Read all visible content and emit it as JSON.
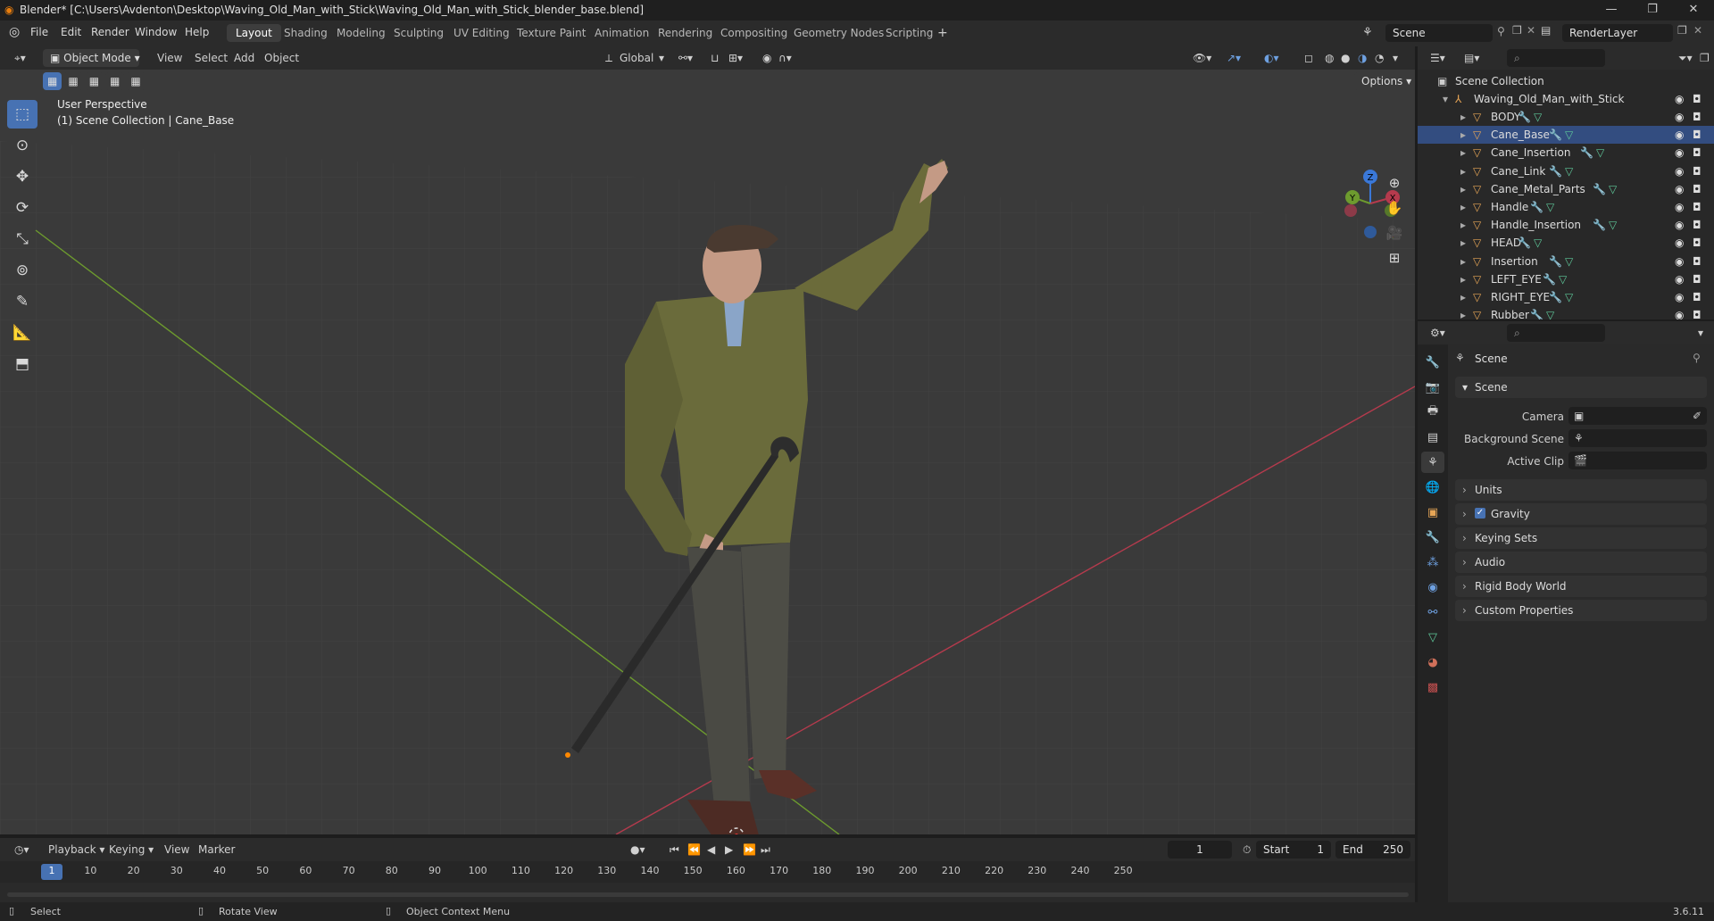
{
  "window": {
    "title": "Blender* [C:\\Users\\Avdenton\\Desktop\\Waving_Old_Man_with_Stick\\Waving_Old_Man_with_Stick_blender_base.blend]",
    "minimize": "—",
    "maximize": "❐",
    "close": "✕"
  },
  "menubar": {
    "menus": [
      "File",
      "Edit",
      "Render",
      "Window",
      "Help"
    ],
    "workspaces": [
      "Layout",
      "Shading",
      "Modeling",
      "Sculpting",
      "UV Editing",
      "Texture Paint",
      "Animation",
      "Rendering",
      "Compositing",
      "Geometry Nodes",
      "Scripting"
    ],
    "active_workspace": "Layout",
    "add_workspace": "+",
    "scene": "Scene",
    "view_layer": "RenderLayer"
  },
  "viewport_header": {
    "mode": "Object Mode",
    "menus": [
      "View",
      "Select",
      "Add",
      "Object"
    ],
    "orientation": "Global",
    "options": "Options"
  },
  "viewport": {
    "perspective": "User Perspective",
    "context": "(1) Scene Collection | Cane_Base",
    "gizmo": {
      "x": "X",
      "y": "Y",
      "z": "Z"
    }
  },
  "timeline": {
    "menus": [
      "Playback",
      "Keying",
      "View",
      "Marker"
    ],
    "current_frame": "1",
    "start_label": "Start",
    "start": "1",
    "end_label": "End",
    "end": "250",
    "ticks": [
      "1",
      "10",
      "20",
      "30",
      "40",
      "50",
      "60",
      "70",
      "80",
      "90",
      "100",
      "110",
      "120",
      "130",
      "140",
      "150",
      "160",
      "170",
      "180",
      "190",
      "200",
      "210",
      "220",
      "230",
      "240",
      "250"
    ]
  },
  "statusbar": {
    "select": "Select",
    "rotate": "Rotate View",
    "context_menu": "Object Context Menu",
    "version": "3.6.11"
  },
  "outliner": {
    "root": "Scene Collection",
    "collection": "Waving_Old_Man_with_Stick",
    "objects": [
      "BODY",
      "Cane_Base",
      "Cane_Insertion",
      "Cane_Link",
      "Cane_Metal_Parts",
      "Handle",
      "Handle_Insertion",
      "HEAD",
      "Insertion",
      "LEFT_EYE",
      "RIGHT_EYE",
      "Rubber"
    ],
    "selected": "Cane_Base"
  },
  "properties": {
    "context": "Scene",
    "scene_panel": "Scene",
    "camera_label": "Camera",
    "background_label": "Background Scene",
    "clip_label": "Active Clip",
    "panels": [
      "Units",
      "Gravity",
      "Keying Sets",
      "Audio",
      "Rigid Body World",
      "Custom Properties"
    ]
  },
  "colors": {
    "accent": "#4772b3",
    "selection": "#334d80",
    "x_axis": "#b53a4d",
    "y_axis": "#6d9b2e",
    "z_axis": "#3a78d8"
  }
}
